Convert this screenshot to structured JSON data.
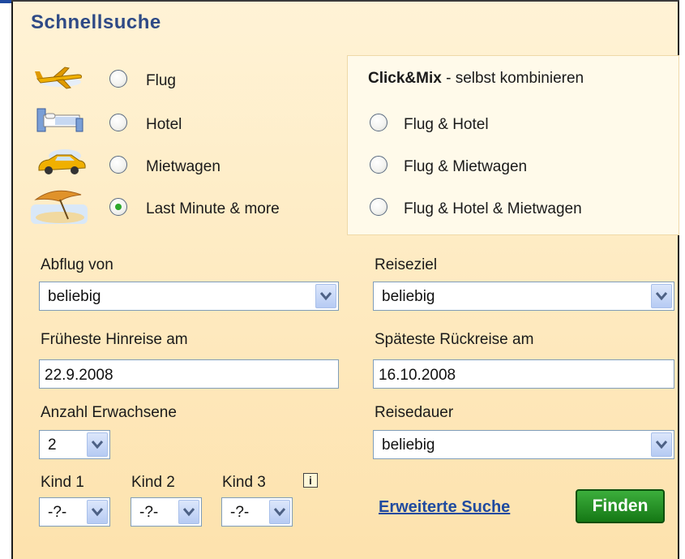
{
  "title": "Schnellsuche",
  "travel_types": [
    {
      "label": "Flug",
      "icon": "airplane-icon",
      "checked": false
    },
    {
      "label": "Hotel",
      "icon": "bed-icon",
      "checked": false
    },
    {
      "label": "Mietwagen",
      "icon": "car-icon",
      "checked": false
    },
    {
      "label": "Last Minute & more",
      "icon": "beach-umbrella-icon",
      "checked": true
    }
  ],
  "clickmix": {
    "brand_bold": "Click&Mix",
    "tagline": " - selbst kombinieren",
    "options": [
      {
        "label": "Flug & Hotel",
        "checked": false
      },
      {
        "label": "Flug & Mietwagen",
        "checked": false
      },
      {
        "label": "Flug & Hotel & Mietwagen",
        "checked": false
      }
    ]
  },
  "form": {
    "departure": {
      "label": "Abflug von",
      "value": "beliebig"
    },
    "destination": {
      "label": "Reiseziel",
      "value": "beliebig"
    },
    "earliest": {
      "label": "Früheste Hinreise am",
      "value": "22.9.2008"
    },
    "latest": {
      "label": "Späteste Rückreise am",
      "value": "16.10.2008"
    },
    "adults": {
      "label": "Anzahl Erwachsene",
      "value": "2"
    },
    "duration": {
      "label": "Reisedauer",
      "value": "beliebig"
    },
    "children": [
      {
        "label": "Kind 1",
        "value": "-?-"
      },
      {
        "label": "Kind 2",
        "value": "-?-"
      },
      {
        "label": "Kind 3",
        "value": "-?-"
      }
    ],
    "info_glyph": "i"
  },
  "actions": {
    "advanced_search": "Erweiterte Suche",
    "find": "Finden"
  },
  "colors": {
    "title": "#2e4a86",
    "link": "#1f4aa0",
    "find_button": "#1e8a1e",
    "panel_bg": "#fde9bd"
  }
}
